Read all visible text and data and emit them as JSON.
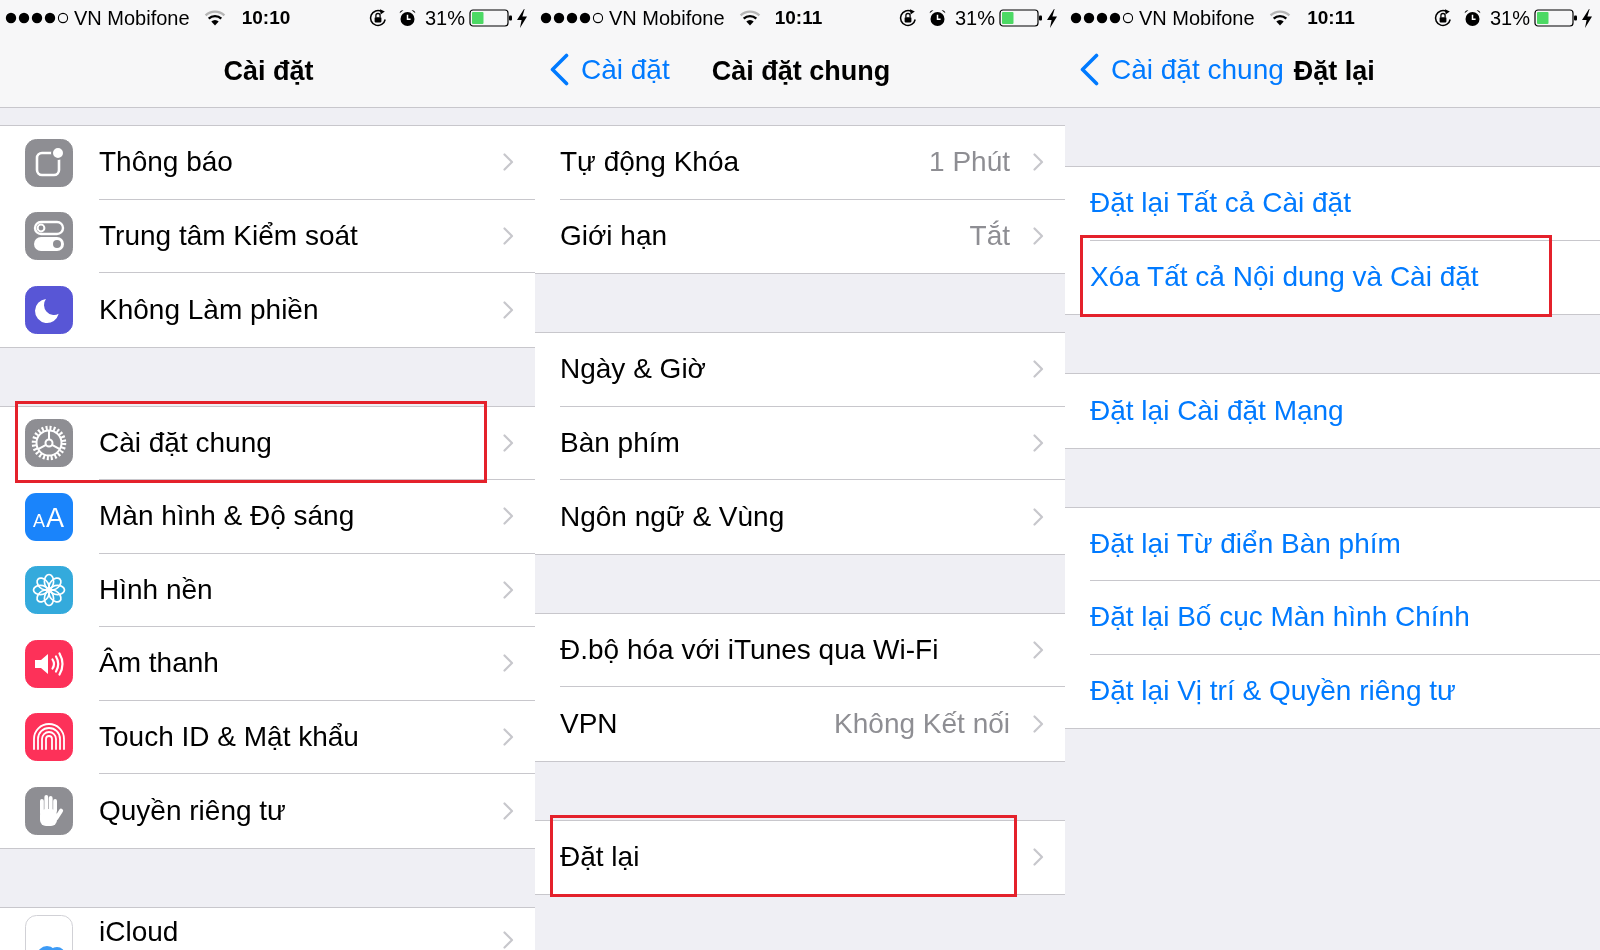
{
  "panels": [
    {
      "status_bar": {
        "carrier": "VN Mobifone",
        "time": "10:10",
        "battery": "31%"
      },
      "nav_bar": {
        "title": "Cài đặt"
      },
      "groups": [
        {
          "rows": [
            {
              "kind": "icon_link",
              "label": "Thông báo",
              "highlighted": false
            },
            {
              "kind": "icon_link",
              "label": "Trung tâm Kiểm soát",
              "highlighted": false
            },
            {
              "kind": "icon_link",
              "label": "Không Làm phiền",
              "highlighted": false
            }
          ]
        },
        {
          "rows": [
            {
              "kind": "icon_link",
              "label": "Cài đặt chung",
              "highlighted": true
            },
            {
              "kind": "icon_link",
              "label": "Màn hình & Độ sáng",
              "icon_text": "AA",
              "highlighted": false
            },
            {
              "kind": "icon_link",
              "label": "Hình nền",
              "highlighted": false
            },
            {
              "kind": "icon_link",
              "label": "Âm thanh",
              "highlighted": false
            },
            {
              "kind": "icon_link",
              "label": "Touch ID & Mật khẩu",
              "highlighted": false
            },
            {
              "kind": "icon_link",
              "label": "Quyền riêng tư",
              "highlighted": false
            }
          ]
        },
        {
          "rows": [
            {
              "kind": "account",
              "label": "iCloud",
              "highlighted": false
            }
          ]
        }
      ]
    },
    {
      "status_bar": {
        "carrier": "VN Mobifone",
        "time": "10:11",
        "battery": "31%"
      },
      "nav_bar": {
        "back": "Cài đặt",
        "title": "Cài đặt chung"
      },
      "groups": [
        {
          "rows": [
            {
              "kind": "link",
              "label": "Tự động Khóa",
              "value": "1 Phút",
              "highlighted": false
            },
            {
              "kind": "link",
              "label": "Giới hạn",
              "value": "Tắt",
              "highlighted": false
            }
          ]
        },
        {
          "rows": [
            {
              "kind": "link",
              "label": "Ngày & Giờ",
              "highlighted": false
            },
            {
              "kind": "link",
              "label": "Bàn phím",
              "highlighted": false
            },
            {
              "kind": "link",
              "label": "Ngôn ngữ & Vùng",
              "highlighted": false
            }
          ]
        },
        {
          "rows": [
            {
              "kind": "link",
              "label": "Đ.bộ hóa với iTunes qua Wi-Fi",
              "highlighted": false
            },
            {
              "kind": "link",
              "label": "VPN",
              "value": "Không Kết nối",
              "highlighted": false
            }
          ]
        },
        {
          "rows": [
            {
              "kind": "link",
              "label": "Đặt lại",
              "highlighted": true
            }
          ]
        }
      ]
    },
    {
      "status_bar": {
        "carrier": "VN Mobifone",
        "time": "10:11",
        "battery": "31%"
      },
      "nav_bar": {
        "back": "Cài đặt chung",
        "title": "Đặt lại"
      },
      "groups": [
        {
          "rows": [
            {
              "kind": "action",
              "label": "Đặt lại Tất cả Cài đặt",
              "highlighted": false
            },
            {
              "kind": "action",
              "label": "Xóa Tất cả Nội dung và Cài đặt",
              "highlighted": true
            }
          ]
        },
        {
          "rows": [
            {
              "kind": "action",
              "label": "Đặt lại Cài đặt Mạng",
              "highlighted": false
            }
          ]
        },
        {
          "rows": [
            {
              "kind": "action",
              "label": "Đặt lại Từ điển Bàn phím",
              "highlighted": false
            },
            {
              "kind": "action",
              "label": "Đặt lại Bố cục Màn hình Chính",
              "highlighted": false
            },
            {
              "kind": "action",
              "label": "Đặt lại Vị trí & Quyền riêng tư",
              "highlighted": false
            }
          ]
        }
      ]
    }
  ]
}
